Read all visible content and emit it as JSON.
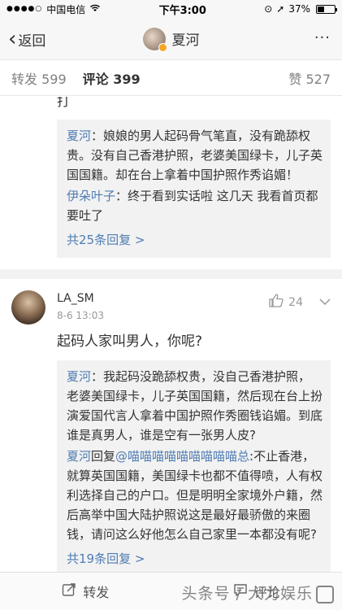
{
  "status": {
    "carrier": "中国电信",
    "time": "下午3:00",
    "battery": "37%"
  },
  "nav": {
    "back_label": "返回",
    "title": "夏河",
    "more": "···"
  },
  "tabs": {
    "repost_label": "转发",
    "repost_count": "599",
    "comments_label": "评论",
    "comments_count": "399",
    "likes_label": "赞",
    "likes_count": "527"
  },
  "thread1": {
    "partial_text": "打",
    "replies": [
      {
        "user": "夏河",
        "text": "：娘娘的男人起码骨气笔直，没有跪舔权贵。没有自己香港护照，老婆美国绿卡，儿子英国国籍。却在台上拿着中国护照作秀谄媚！"
      },
      {
        "user": "伊朵叶子",
        "text": "：终于看到实话啦 这几天 我看首页都要吐了"
      }
    ],
    "more_replies": "共25条回复 >"
  },
  "comment2": {
    "user": "LA_SM",
    "time": "8-6 13:03",
    "likes": "24",
    "text": "起码人家叫男人，你呢?",
    "replies": [
      {
        "user": "夏河",
        "text": "：我起码没跪舔权贵，没自己香港护照，老婆美国绿卡，儿子英国国籍，然后现在台上扮演爱国代言人拿着中国护照作秀圈钱谄媚。到底谁是真男人，谁是空有一张男人皮?"
      },
      {
        "user": "夏河",
        "mid": "回复",
        "mention": "@喵喵喵喵喵喵喵喵喵总",
        "text": ":不止香港，就算英国国籍，美国绿卡也都不值得喷，人有权利选择自己的户口。但是明明全家境外户籍，然后高举中国大陆护照说这是最好最骄傲的来圈钱，请问这么好他怎么自己家里一本都没有呢?"
      }
    ],
    "more_replies": "共19条回复 >"
  },
  "bottom": {
    "repost": "转发",
    "comment": "评论",
    "watermark": "头条号 / 大力娱乐"
  }
}
